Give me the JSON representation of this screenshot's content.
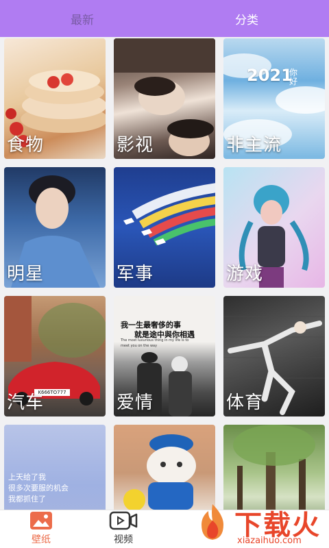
{
  "tabs": [
    {
      "label": "最新",
      "active": false
    },
    {
      "label": "分类",
      "active": true
    }
  ],
  "cards": [
    {
      "label": "食物"
    },
    {
      "label": "影视"
    },
    {
      "label": "非主流",
      "overlay_text": "2021",
      "overlay_small": "你好"
    },
    {
      "label": "明星"
    },
    {
      "label": "军事"
    },
    {
      "label": "游戏"
    },
    {
      "label": "汽车",
      "plate": "K666TO777"
    },
    {
      "label": "爱情",
      "quote_line1": "我一生最奢侈的事",
      "quote_line2": "就是途中與你相遇",
      "quote_en1": "The most luxurious thing in my life is to",
      "quote_en2": "meet you on the way"
    },
    {
      "label": "体育"
    },
    {
      "label": "",
      "handwriting_line1": "上天给了我",
      "handwriting_line2": "很多次要服的机会",
      "handwriting_line3": "我都抓住了"
    },
    {
      "label": ""
    },
    {
      "label": ""
    }
  ],
  "bottom_nav": [
    {
      "label": "壁纸",
      "icon": "image-icon",
      "active": true
    },
    {
      "label": "视频",
      "icon": "video-icon",
      "active": false
    }
  ],
  "watermark": {
    "brand": "下载火",
    "url": "xiazaihuo.com"
  },
  "colors": {
    "accent": "#b07cf2",
    "active_nav": "#ec6c4a",
    "watermark": "#e8462a"
  }
}
